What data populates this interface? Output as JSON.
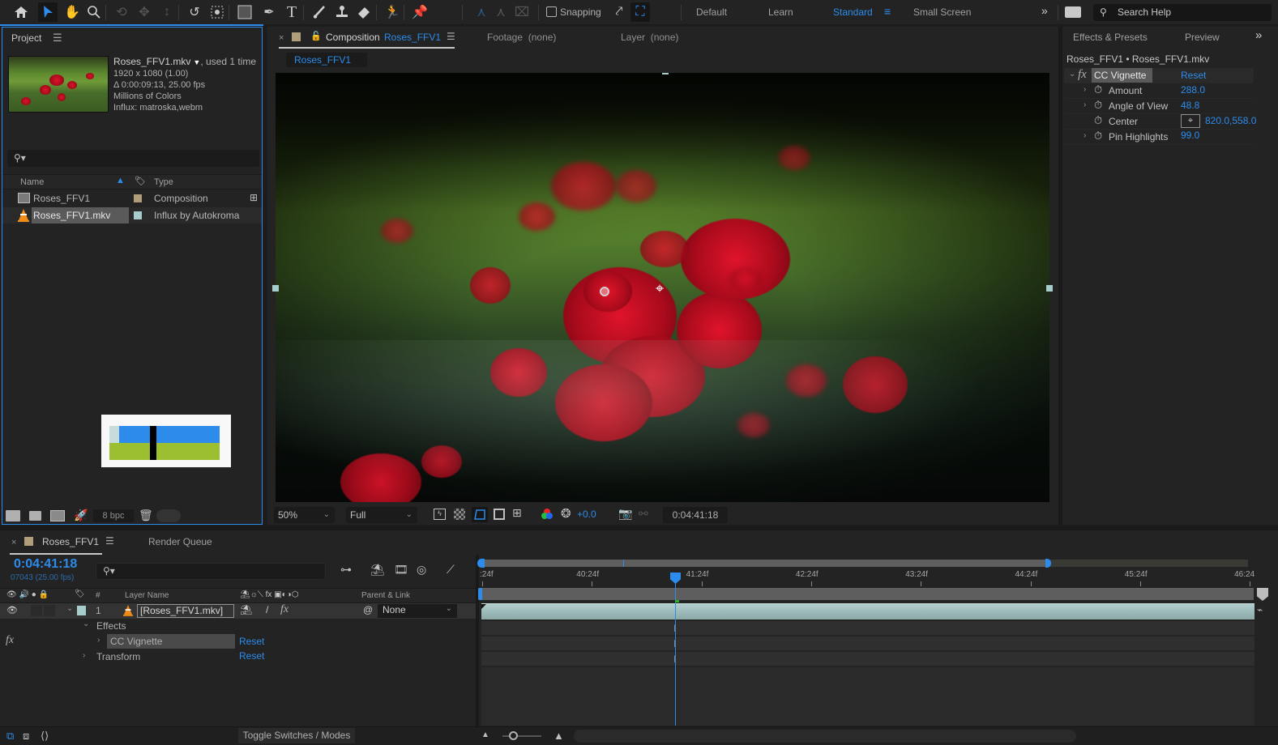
{
  "toolbar": {
    "tools": [
      "home-icon",
      "selection-tool-icon",
      "hand-tool-icon",
      "zoom-tool-icon",
      "orbit-camera-icon",
      "pan-camera-icon",
      "dolly-camera-icon",
      "rotation-tool-icon",
      "pan-behind-icon",
      "rectangle-tool-icon",
      "pen-tool-icon",
      "type-tool-icon",
      "brush-tool-icon",
      "clone-stamp-icon",
      "eraser-icon",
      "roto-brush-icon",
      "puppet-pin-icon"
    ],
    "snapping_label": "Snapping",
    "workspaces": [
      "Default",
      "Learn",
      "Standard",
      "Small Screen"
    ],
    "active_workspace": "Standard",
    "search_placeholder": "Search Help"
  },
  "project": {
    "title": "Project",
    "selected_file": {
      "name": "Roses_FFV1.mkv",
      "usage": ", used 1 time",
      "resolution": "1920 x 1080 (1.00)",
      "duration": "Δ 0:00:09:13, 25.00 fps",
      "colors": "Millions of Colors",
      "codec": "Influx: matroska,webm"
    },
    "columns": {
      "name": "Name",
      "type": "Type"
    },
    "items": [
      {
        "name": "Roses_FFV1",
        "type": "Composition",
        "label_color": "#b09e7a",
        "icon": "composition-icon"
      },
      {
        "name": "Roses_FFV1.mkv",
        "type": "Influx by Autokroma",
        "label_color": "#a7cccc",
        "icon": "vlc-cone-icon",
        "selected": true
      }
    ],
    "bit_depth": "8 bpc"
  },
  "composition": {
    "tab_label": "Composition",
    "tab_name": "Roses_FFV1",
    "footage_tab": "Footage",
    "footage_value": "(none)",
    "layer_tab": "Layer",
    "layer_value": "(none)",
    "sub_tab": "Roses_FFV1",
    "zoom": "50%",
    "resolution": "Full",
    "exposure": "+0.0",
    "timecode": "0:04:41:18"
  },
  "effects_panel": {
    "tab_effects": "Effects & Presets",
    "tab_preview": "Preview",
    "source": "Roses_FFV1 • Roses_FFV1.mkv",
    "effect_name": "CC Vignette",
    "reset_label": "Reset",
    "properties": [
      {
        "name": "Amount",
        "value": "288.0",
        "expandable": true
      },
      {
        "name": "Angle of View",
        "value": "48.8",
        "expandable": true
      },
      {
        "name": "Center",
        "value": "820.0,558.0",
        "expandable": false,
        "point": true
      },
      {
        "name": "Pin Highlights",
        "value": "99.0",
        "expandable": true
      }
    ]
  },
  "timeline": {
    "comp_tab": "Roses_FFV1",
    "render_queue_tab": "Render Queue",
    "current_time": "0:04:41:18",
    "frame_info": "07043 (25.00 fps)",
    "columns": {
      "number": "#",
      "layer_name": "Layer Name",
      "parent": "Parent & Link"
    },
    "layer": {
      "index": "1",
      "name": "[Roses_FFV1.mkv]",
      "parent": "None",
      "label_color": "#a7cccc"
    },
    "effects_group": "Effects",
    "effect_name": "CC Vignette",
    "transform": "Transform",
    "reset_label": "Reset",
    "ruler_labels": [
      ":24f",
      "40:24f",
      "41:24f",
      "42:24f",
      "43:24f",
      "44:24f",
      "45:24f",
      "46:24"
    ],
    "playhead_time": "0:04:41:18",
    "toggle_label": "Toggle Switches / Modes"
  }
}
